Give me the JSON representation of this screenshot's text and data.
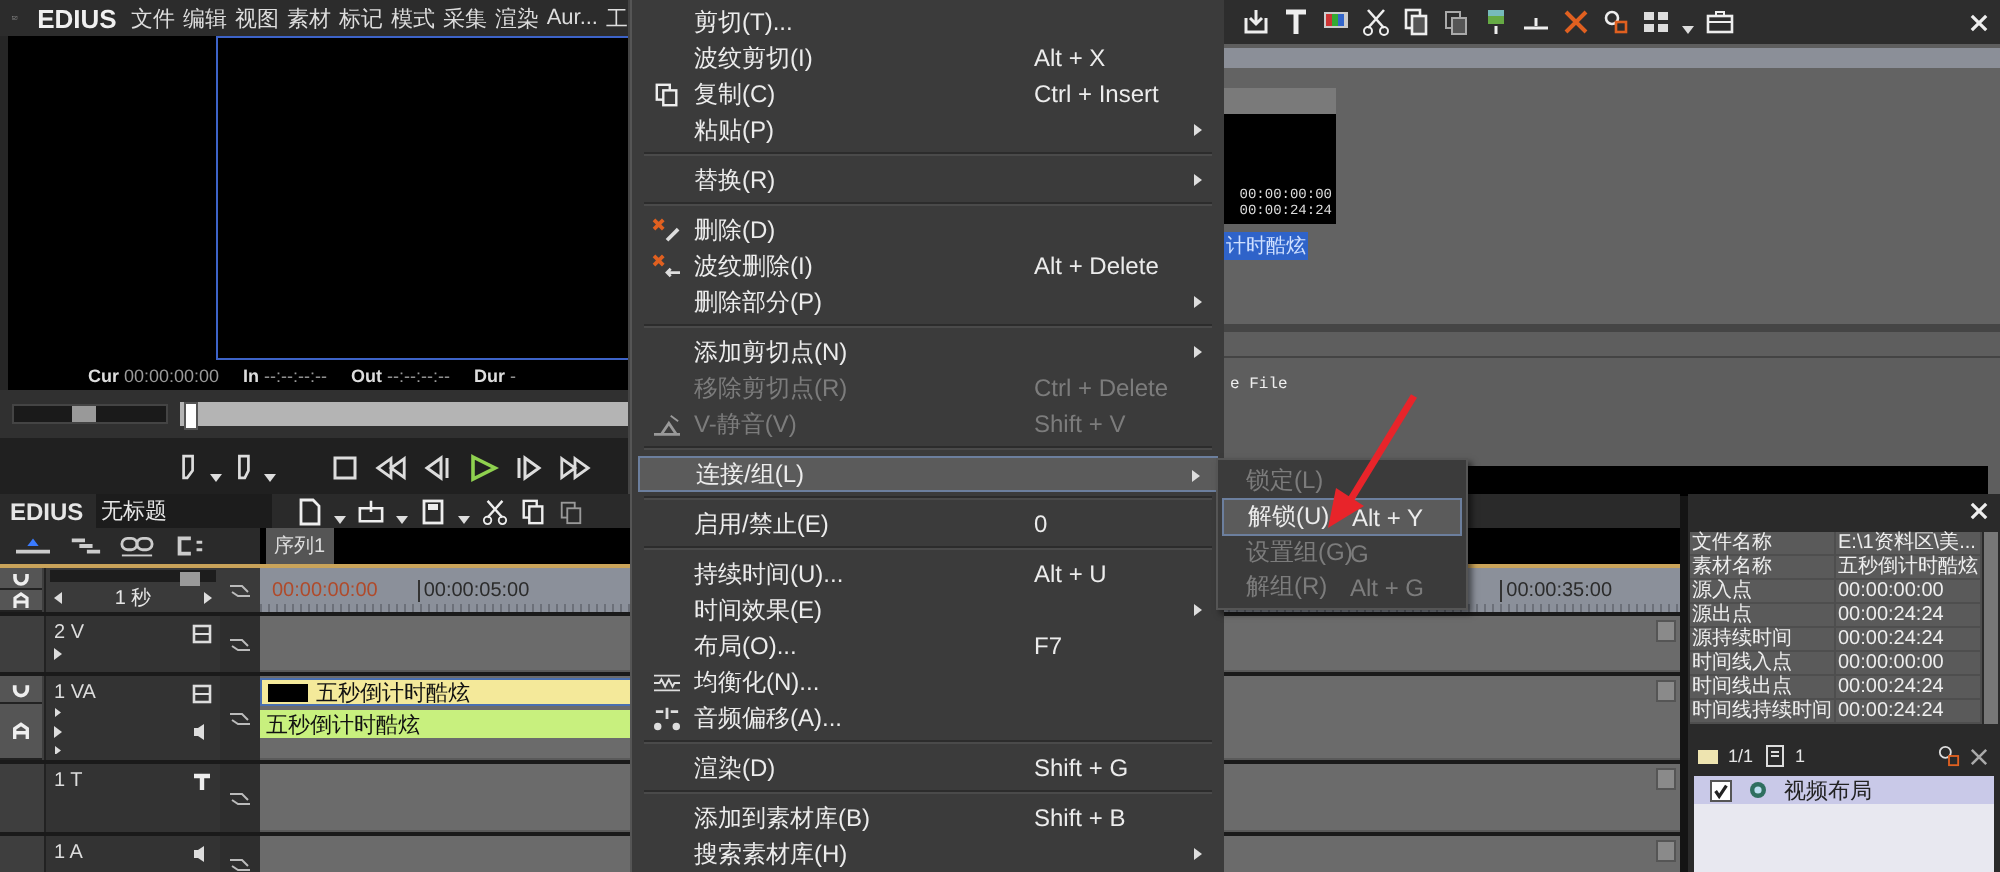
{
  "player": {
    "logo": "EDIUS",
    "menu": [
      "文件",
      "编辑",
      "视图",
      "素材",
      "标记",
      "模式",
      "采集",
      "渲染",
      "Aur...",
      "工"
    ],
    "timecodes": [
      {
        "label": "Cur",
        "value": "00:00:00:00"
      },
      {
        "label": "In",
        "value": "--:--:--:--"
      },
      {
        "label": "Out",
        "value": "--:--:--:--"
      },
      {
        "label": "Dur",
        "value": "-"
      }
    ],
    "shuttle": {
      "level": 0.45
    }
  },
  "bin": {
    "clip": {
      "tc_in": "00:00:00:00",
      "tc_out": "00:00:24:24",
      "name": "计时酷炫",
      "selected": true
    },
    "column_text": "e File"
  },
  "timeline": {
    "logo": "EDIUS",
    "project": "无标题",
    "sequence_tab": "序列1",
    "zoom": "1 秒",
    "zoom_slider": {
      "level": 0.92
    },
    "ruler": [
      "00:00:00:00",
      "00:00:05:00",
      "00:00:35:00"
    ],
    "tracks": [
      {
        "name": "2 V",
        "kind": "video"
      },
      {
        "name": "1 VA",
        "kind": "va",
        "clips": [
          {
            "kind": "video",
            "name": "五秒倒计时酷炫"
          },
          {
            "kind": "audio",
            "name": "五秒倒计时酷炫"
          }
        ]
      },
      {
        "name": "1 T",
        "kind": "title"
      },
      {
        "name": "1 A",
        "kind": "audio"
      }
    ]
  },
  "info": {
    "rows": [
      {
        "name": "文件名称",
        "value": "E:\\1资料区\\美..."
      },
      {
        "name": "素材名称",
        "value": "五秒倒计时酷炫"
      },
      {
        "name": "源入点",
        "value": "00:00:00:00"
      },
      {
        "name": "源出点",
        "value": "00:00:24:24"
      },
      {
        "name": "源持续时间",
        "value": "00:00:24:24"
      },
      {
        "name": "时间线入点",
        "value": "00:00:00:00"
      },
      {
        "name": "时间线出点",
        "value": "00:00:24:24"
      },
      {
        "name": "时间线持续时间",
        "value": "00:00:24:24"
      }
    ],
    "page": "1/1",
    "count": "1",
    "layouts": [
      {
        "label": "视频布局",
        "checked": true
      }
    ]
  },
  "context_menu": {
    "items": [
      {
        "kind": "item",
        "label": "剪切(T)...",
        "disabled": false,
        "highlighted": false,
        "submenu": false
      },
      {
        "kind": "item",
        "label": "波纹剪切(I)",
        "shortcut": "Alt + X",
        "disabled": false,
        "highlighted": false,
        "submenu": false
      },
      {
        "kind": "item",
        "label": "复制(C)",
        "shortcut": "Ctrl + Insert",
        "disabled": false,
        "highlighted": false,
        "submenu": false
      },
      {
        "kind": "item",
        "label": "粘贴(P)",
        "disabled": false,
        "highlighted": false,
        "submenu": true
      },
      {
        "kind": "separator"
      },
      {
        "kind": "item",
        "label": "替换(R)",
        "disabled": false,
        "highlighted": false,
        "submenu": true
      },
      {
        "kind": "separator"
      },
      {
        "kind": "item",
        "label": "删除(D)",
        "disabled": false,
        "highlighted": false,
        "submenu": false
      },
      {
        "kind": "item",
        "label": "波纹删除(I)",
        "shortcut": "Alt + Delete",
        "disabled": false,
        "highlighted": false,
        "submenu": false
      },
      {
        "kind": "item",
        "label": "删除部分(P)",
        "disabled": false,
        "highlighted": false,
        "submenu": true
      },
      {
        "kind": "separator"
      },
      {
        "kind": "item",
        "label": "添加剪切点(N)",
        "disabled": false,
        "highlighted": false,
        "submenu": true
      },
      {
        "kind": "item",
        "label": "移除剪切点(R)",
        "shortcut": "Ctrl + Delete",
        "disabled": true,
        "highlighted": false,
        "submenu": false
      },
      {
        "kind": "item",
        "label": "V-静音(V)",
        "shortcut": "Shift + V",
        "disabled": true,
        "highlighted": false,
        "submenu": false
      },
      {
        "kind": "separator"
      },
      {
        "kind": "item",
        "label": "连接/组(L)",
        "disabled": false,
        "highlighted": true,
        "submenu": true
      },
      {
        "kind": "separator"
      },
      {
        "kind": "item",
        "label": "启用/禁止(E)",
        "shortcut": "0",
        "disabled": false,
        "highlighted": false,
        "submenu": false
      },
      {
        "kind": "separator"
      },
      {
        "kind": "item",
        "label": "持续时间(U)...",
        "shortcut": "Alt + U",
        "disabled": false,
        "highlighted": false,
        "submenu": false
      },
      {
        "kind": "item",
        "label": "时间效果(E)",
        "disabled": false,
        "highlighted": false,
        "submenu": true
      },
      {
        "kind": "item",
        "label": "布局(O)...",
        "shortcut": "F7",
        "disabled": false,
        "highlighted": false,
        "submenu": false
      },
      {
        "kind": "item",
        "label": "均衡化(N)...",
        "disabled": false,
        "highlighted": false,
        "submenu": false
      },
      {
        "kind": "item",
        "label": "音频偏移(A)...",
        "disabled": false,
        "highlighted": false,
        "submenu": false
      },
      {
        "kind": "separator"
      },
      {
        "kind": "item",
        "label": "渲染(D)",
        "shortcut": "Shift + G",
        "disabled": false,
        "highlighted": false,
        "submenu": false
      },
      {
        "kind": "separator"
      },
      {
        "kind": "item",
        "label": "添加到素材库(B)",
        "shortcut": "Shift + B",
        "disabled": false,
        "highlighted": false,
        "submenu": false
      },
      {
        "kind": "item",
        "label": "搜索素材库(H)",
        "disabled": false,
        "highlighted": false,
        "submenu": true
      }
    ]
  },
  "submenu": {
    "items": [
      {
        "label": "锁定(L)",
        "disabled": true,
        "highlighted": false
      },
      {
        "label": "解锁(U)",
        "shortcut": "Alt + Y",
        "disabled": false,
        "highlighted": true
      },
      {
        "label": "设置组(G)",
        "shortcut": "G",
        "disabled": true,
        "highlighted": false
      },
      {
        "label": "解组(R)",
        "shortcut": "Alt + G",
        "disabled": true,
        "highlighted": false
      }
    ]
  }
}
